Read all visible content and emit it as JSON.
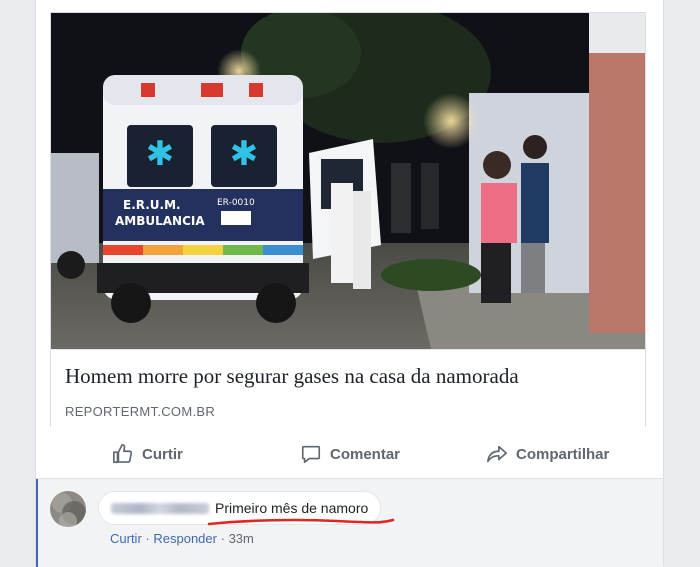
{
  "post": {
    "headline": "Homem morre por segurar gases na casa da namorada",
    "domain": "REPORTERMT.COM.BR",
    "image": {
      "ambulance_text_1": "E.R.U.M.",
      "ambulance_text_2": "AMBULANCIA",
      "ambulance_code": "ER-0010"
    }
  },
  "actions": {
    "like_label": "Curtir",
    "comment_label": "Comentar",
    "share_label": "Compartilhar"
  },
  "comment": {
    "text": "Primeiro mês de namoro",
    "like_link": "Curtir",
    "reply_link": "Responder",
    "separator": "·",
    "time": "33m"
  },
  "colors": {
    "accent": "#4267b2",
    "underline": "#e0261f",
    "muted_text": "#606770"
  }
}
